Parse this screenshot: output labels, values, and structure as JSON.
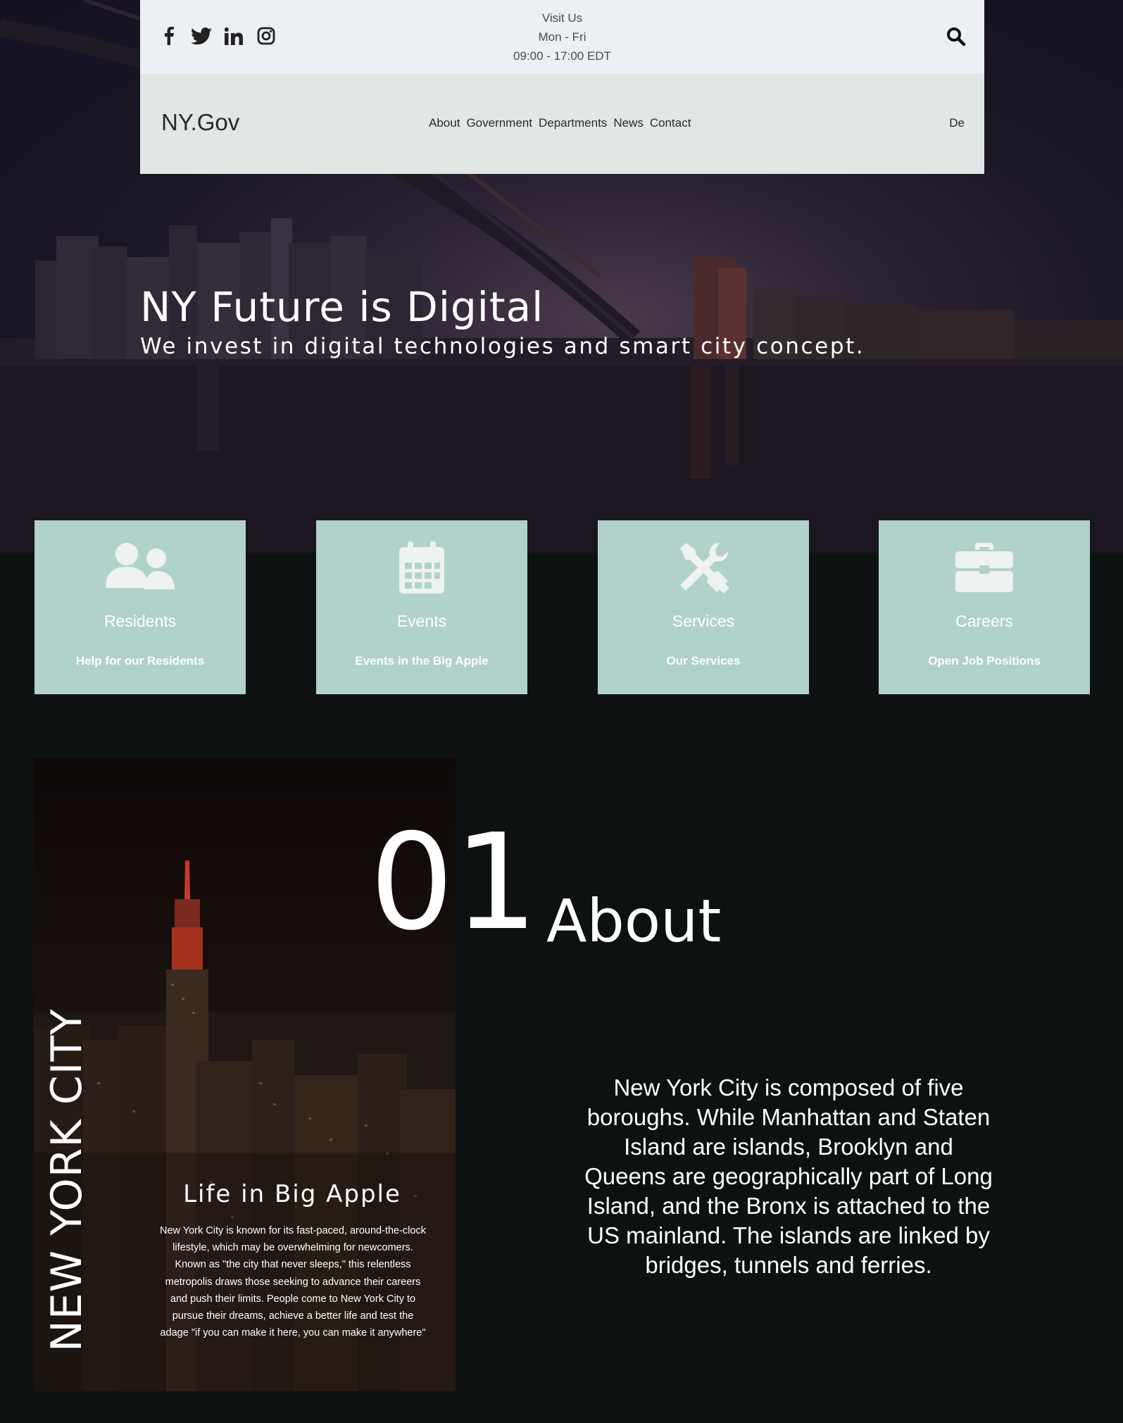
{
  "topbar": {
    "social": [
      "facebook-icon",
      "twitter-icon",
      "linkedin-icon",
      "instagram-icon"
    ],
    "visit_label": "Visit Us",
    "days": "Mon - Fri",
    "hours": "09:00 - 17:00 EDT"
  },
  "nav": {
    "brand": "NY.Gov",
    "links": [
      "About",
      "Government",
      "Departments",
      "News",
      "Contact"
    ],
    "lang": "De"
  },
  "hero": {
    "title": "NY Future is Digital",
    "subtitle": "We invest in digital technologies and smart city concept."
  },
  "cards": [
    {
      "icon": "users-icon",
      "title": "Residents",
      "desc": "Help for our Residents"
    },
    {
      "icon": "calendar-icon",
      "title": "Events",
      "desc": "Events in the Big Apple"
    },
    {
      "icon": "tools-icon",
      "title": "Services",
      "desc": "Our Services"
    },
    {
      "icon": "briefcase-icon",
      "title": "Careers",
      "desc": "Open Job Positions"
    }
  ],
  "about": {
    "vertical": "NEW YORK CITY",
    "life_title": "Life in Big Apple",
    "life_text": "New York City is known for its fast-paced, around-the-clock lifestyle, which may be overwhelming for newcomers. Known as \"the city that never sleeps,\" this relentless metropolis draws those seeking to advance their careers and push their limits. People come to New York City to pursue their dreams, achieve a better life and test the adage \"if you can make it here, you can make it anywhere\"",
    "number": "01",
    "heading": "About",
    "text": "New York City is composed of five boroughs. While Manhattan and Staten Island are islands, Brooklyn and Queens are geographically part of Long Island, and the Bronx is attached to the US mainland. The islands are linked by bridges, tunnels and ferries."
  },
  "colors": {
    "card_bg": "#b1d2ca",
    "topbar_bg": "#eceff3",
    "navbar_bg": "#e0e7e4",
    "page_bg": "#0e1111"
  }
}
